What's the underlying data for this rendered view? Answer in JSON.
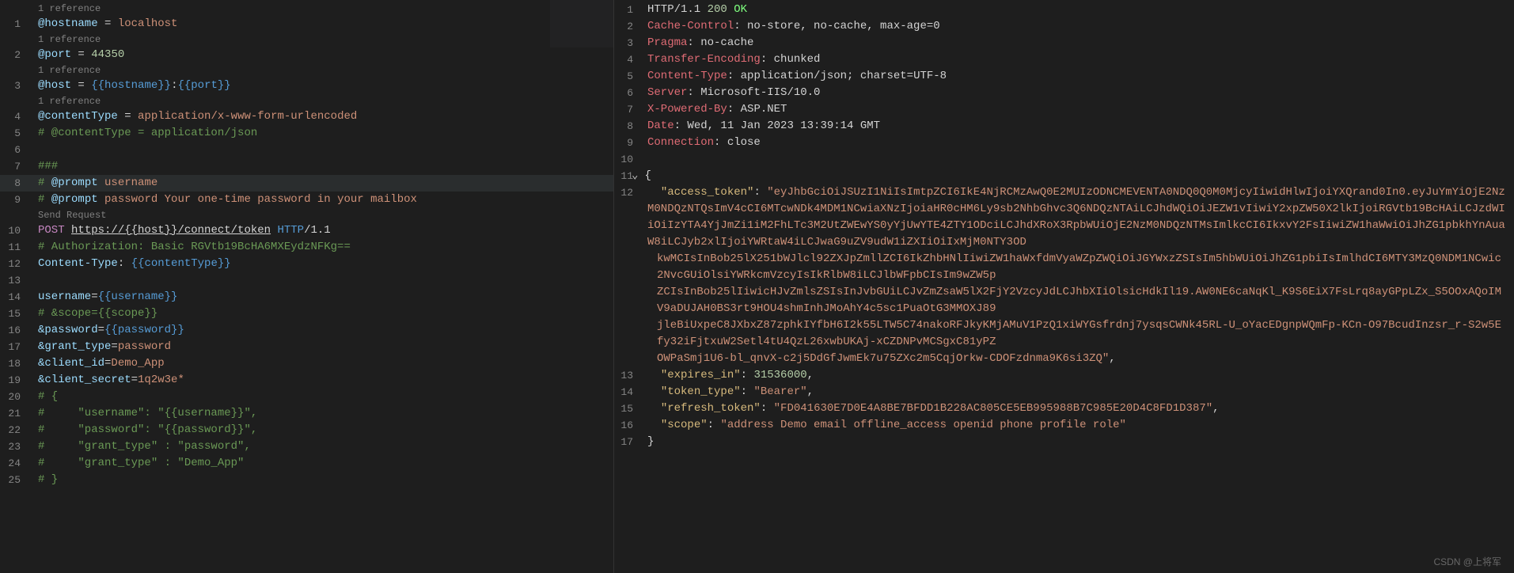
{
  "watermark": "CSDN @上将军",
  "left": {
    "codelens": {
      "references1": "1 reference",
      "send": "Send Request"
    },
    "lines": [
      {
        "n": "",
        "codelens": "references1"
      },
      {
        "n": "1",
        "bar": "",
        "tokens": [
          [
            "@hostname",
            "var"
          ],
          [
            " = ",
            "op"
          ],
          [
            "localhost",
            "val"
          ]
        ]
      },
      {
        "n": "",
        "codelens": "references1"
      },
      {
        "n": "2",
        "bar": "",
        "tokens": [
          [
            "@port",
            "var"
          ],
          [
            " = ",
            "op"
          ],
          [
            "44350",
            "num"
          ]
        ]
      },
      {
        "n": "",
        "codelens": "references1"
      },
      {
        "n": "3",
        "bar": "",
        "tokens": [
          [
            "@host",
            "var"
          ],
          [
            " = ",
            "op"
          ],
          [
            "{{hostname}}",
            "tpl"
          ],
          [
            ":",
            "op"
          ],
          [
            "{{port}}",
            "tpl"
          ]
        ]
      },
      {
        "n": "",
        "codelens": "references1"
      },
      {
        "n": "4",
        "bar": "",
        "tokens": [
          [
            "@contentType",
            "var"
          ],
          [
            " = ",
            "op"
          ],
          [
            "application/x-www-form-urlencoded",
            "val"
          ]
        ]
      },
      {
        "n": "5",
        "bar": "blue",
        "tokens": [
          [
            "# @contentType = application/json",
            "cmt"
          ]
        ]
      },
      {
        "n": "6",
        "bar": "",
        "tokens": [
          [
            "",
            "op"
          ]
        ]
      },
      {
        "n": "7",
        "bar": "",
        "tokens": [
          [
            "###",
            "cmt"
          ]
        ]
      },
      {
        "n": "8",
        "bar": "",
        "active": true,
        "tokens": [
          [
            "# ",
            "cmt"
          ],
          [
            "@prompt",
            "var"
          ],
          [
            " ",
            "op"
          ],
          [
            "username",
            "val"
          ]
        ]
      },
      {
        "n": "9",
        "bar": "",
        "tokens": [
          [
            "# ",
            "cmt"
          ],
          [
            "@prompt",
            "var"
          ],
          [
            " ",
            "op"
          ],
          [
            "password",
            "val"
          ],
          [
            " ",
            "op"
          ],
          [
            "Your one-time password in your mailbox",
            "val"
          ]
        ]
      },
      {
        "n": "",
        "codelens": "send"
      },
      {
        "n": "10",
        "bar": "",
        "tokens": [
          [
            "POST",
            "mtd"
          ],
          [
            " ",
            "op"
          ],
          [
            "https://{{host}}/connect/token",
            "url"
          ],
          [
            " ",
            "op"
          ],
          [
            "HTTP",
            "kw"
          ],
          [
            "/1.1",
            "op"
          ]
        ]
      },
      {
        "n": "11",
        "bar": "blue",
        "tokens": [
          [
            "# Authorization: Basic RGVtb19BcHA6MXEydzNFKg==",
            "cmt"
          ]
        ]
      },
      {
        "n": "12",
        "bar": "",
        "tokens": [
          [
            "Content-Type",
            "var"
          ],
          [
            ": ",
            "op"
          ],
          [
            "{{contentType}}",
            "tpl"
          ]
        ]
      },
      {
        "n": "13",
        "bar": "",
        "tokens": [
          [
            "",
            "op"
          ]
        ]
      },
      {
        "n": "14",
        "bar": "",
        "tokens": [
          [
            "username",
            "var"
          ],
          [
            "=",
            "op"
          ],
          [
            "{{username}}",
            "tpl"
          ]
        ]
      },
      {
        "n": "15",
        "bar": "blue",
        "tokens": [
          [
            "# &scope={{scope}}",
            "cmt"
          ]
        ]
      },
      {
        "n": "16",
        "bar": "",
        "tokens": [
          [
            "&password",
            "var"
          ],
          [
            "=",
            "op"
          ],
          [
            "{{password}}",
            "tpl"
          ]
        ]
      },
      {
        "n": "17",
        "bar": "",
        "tokens": [
          [
            "&grant_type",
            "var"
          ],
          [
            "=",
            "op"
          ],
          [
            "password",
            "val"
          ]
        ]
      },
      {
        "n": "18",
        "bar": "",
        "tokens": [
          [
            "&client_id",
            "var"
          ],
          [
            "=",
            "op"
          ],
          [
            "Demo_App",
            "val"
          ]
        ]
      },
      {
        "n": "19",
        "bar": "blue",
        "tokens": [
          [
            "&client_secret",
            "var"
          ],
          [
            "=",
            "op"
          ],
          [
            "1q2w3e*",
            "val"
          ]
        ]
      },
      {
        "n": "20",
        "bar": "",
        "tokens": [
          [
            "# {",
            "cmt"
          ]
        ]
      },
      {
        "n": "21",
        "bar": "blue",
        "tokens": [
          [
            "#     \"username\": \"{{username}}\",",
            "cmt"
          ]
        ]
      },
      {
        "n": "22",
        "bar": "blue",
        "tokens": [
          [
            "#     \"password\": \"{{password}}\",",
            "cmt"
          ]
        ]
      },
      {
        "n": "23",
        "bar": "blue",
        "tokens": [
          [
            "#     \"grant_type\" : \"password\",",
            "cmt"
          ]
        ]
      },
      {
        "n": "24",
        "bar": "blue",
        "tokens": [
          [
            "#     \"grant_type\" : \"Demo_App\"",
            "cmt"
          ]
        ]
      },
      {
        "n": "25",
        "bar": "",
        "tokens": [
          [
            "# }",
            "cmt"
          ]
        ]
      }
    ]
  },
  "right": {
    "lines": [
      {
        "n": "1",
        "tokens": [
          [
            "HTTP/1.1 ",
            "ht"
          ],
          [
            "200",
            "ok"
          ],
          [
            " ",
            "ht"
          ],
          [
            "OK",
            "okw"
          ]
        ]
      },
      {
        "n": "2",
        "tokens": [
          [
            "Cache-Control",
            "hdr"
          ],
          [
            ":",
            "ht"
          ],
          [
            " no-store, no-cache, max-age=0",
            "ht"
          ]
        ]
      },
      {
        "n": "3",
        "tokens": [
          [
            "Pragma",
            "hdr"
          ],
          [
            ":",
            "ht"
          ],
          [
            " no-cache",
            "ht"
          ]
        ]
      },
      {
        "n": "4",
        "tokens": [
          [
            "Transfer-Encoding",
            "hdr"
          ],
          [
            ":",
            "ht"
          ],
          [
            " chunked",
            "ht"
          ]
        ]
      },
      {
        "n": "5",
        "tokens": [
          [
            "Content-Type",
            "hdr"
          ],
          [
            ":",
            "ht"
          ],
          [
            " application/json; charset=UTF-8",
            "ht"
          ]
        ]
      },
      {
        "n": "6",
        "tokens": [
          [
            "Server",
            "hdr"
          ],
          [
            ":",
            "ht"
          ],
          [
            " Microsoft-IIS/10.0",
            "ht"
          ]
        ]
      },
      {
        "n": "7",
        "tokens": [
          [
            "X-Powered-By",
            "hdr"
          ],
          [
            ":",
            "ht"
          ],
          [
            " ASP.NET",
            "ht"
          ]
        ]
      },
      {
        "n": "8",
        "tokens": [
          [
            "Date",
            "hdr"
          ],
          [
            ":",
            "ht"
          ],
          [
            " Wed, 11 Jan 2023 13:39:14 GMT",
            "ht"
          ]
        ]
      },
      {
        "n": "9",
        "tokens": [
          [
            "Connection",
            "hdr"
          ],
          [
            ":",
            "ht"
          ],
          [
            " close",
            "ht"
          ]
        ]
      },
      {
        "n": "10",
        "tokens": [
          [
            "",
            "ht"
          ]
        ]
      },
      {
        "n": "11",
        "fold": true,
        "tokens": [
          [
            "{",
            "pun"
          ]
        ]
      },
      {
        "n": "12",
        "tokens": [
          [
            "  ",
            "pun"
          ],
          [
            "\"access_token\"",
            "key"
          ],
          [
            ":",
            "pun"
          ],
          [
            " ",
            "pun"
          ],
          [
            "\"eyJhbGciOiJSUzI1NiIsImtpZCI6IkE4NjRCMzAwQ0E2MUIzODNCMEVENTA0NDQ0Q0M0MjcyIiwidHlwIjoiYXQrand0In0.eyJuYmYiOjE2NzM0NDQzNTQsImV4cCI6MTcwNDk4MDM1NCwiaXNzIjoiaHR0cHM6Ly9sb2NhbGhvc3Q6NDQzNTAiLCJhdWQiOiJEZW1vIiwiY2xpZW50X2lkIjoiRGVtb19BcHAiLCJzdWIiOiIzYTA4YjJmZi1iM2FhLTc3M2UtZWEwYS0yYjUwYTE4ZTY1ODciLCJhdXRoX3RpbWUiOjE2NzM0NDQzNTMsImlkcCI6IkxvY2FsIiwiZW1haWwiOiJhZG1pbkhYnAuaW8iLCJyb2xlIjoiYWRtaW4iLCJwaG9uZV9udW1iZXIiOiIxMjM0NTY3OD",
            "str"
          ]
        ]
      },
      {
        "n": "",
        "cont": true,
        "tokens": [
          [
            "kwMCIsInBob25lX251bWJlcl92ZXJpZmllZCI6IkZhbHNlIiwiZW1haWxfdmVyaWZpZWQiOiJGYWxzZSIsIm5hbWUiOiJhZG1pbiIsImlhdCI6MTY3MzQ0NDM1NCwic2NvcGUiOlsiYWRkcmVzcyIsIkRlbW8iLCJlbWFpbCIsIm9wZW5p",
            "str"
          ]
        ]
      },
      {
        "n": "",
        "cont": true,
        "tokens": [
          [
            "ZCIsInBob25lIiwicHJvZmlsZSIsInJvbGUiLCJvZmZsaW5lX2FjY2VzcyJdLCJhbXIiOlsicHdkIl19.AW0NE6caNqKl_K9S6EiX7FsLrq8ayGPpLZx_S5OOxAQoIMV9aDUJAH0BS3rt9HOU4shmInhJMoAhY4c5sc1PuaOtG3MMOXJ89",
            "str"
          ]
        ]
      },
      {
        "n": "",
        "cont": true,
        "tokens": [
          [
            "jleBiUxpeC8JXbxZ87zphkIYfbH6I2k55LTW5C74nakoRFJkyKMjAMuV1PzQ1xiWYGsfrdnj7ysqsCWNk45RL-U_oYacEDgnpWQmFp-KCn-O97BcudInzsr_r-S2w5Efy32iFjtxuW2Setl4tU4QzL26xwbUKAj-xCZDNPvMCSgxC81yPZ",
            "str"
          ]
        ]
      },
      {
        "n": "",
        "cont": true,
        "tokens": [
          [
            "OWPaSmj1U6-bl_qnvX-c2j5DdGfJwmEk7u75ZXc2m5CqjOrkw-CDOFzdnma9K6si3ZQ\"",
            "str"
          ],
          [
            ",",
            "pun"
          ]
        ]
      },
      {
        "n": "13",
        "tokens": [
          [
            "  ",
            "pun"
          ],
          [
            "\"expires_in\"",
            "key"
          ],
          [
            ":",
            "pun"
          ],
          [
            " ",
            "pun"
          ],
          [
            "31536000",
            "num"
          ],
          [
            ",",
            "pun"
          ]
        ]
      },
      {
        "n": "14",
        "tokens": [
          [
            "  ",
            "pun"
          ],
          [
            "\"token_type\"",
            "key"
          ],
          [
            ":",
            "pun"
          ],
          [
            " ",
            "pun"
          ],
          [
            "\"Bearer\"",
            "str"
          ],
          [
            ",",
            "pun"
          ]
        ]
      },
      {
        "n": "15",
        "tokens": [
          [
            "  ",
            "pun"
          ],
          [
            "\"refresh_token\"",
            "key"
          ],
          [
            ":",
            "pun"
          ],
          [
            " ",
            "pun"
          ],
          [
            "\"FD041630E7D0E4A8BE7BFDD1B228AC805CE5EB995988B7C985E20D4C8FD1D387\"",
            "str"
          ],
          [
            ",",
            "pun"
          ]
        ]
      },
      {
        "n": "16",
        "tokens": [
          [
            "  ",
            "pun"
          ],
          [
            "\"scope\"",
            "key"
          ],
          [
            ":",
            "pun"
          ],
          [
            " ",
            "pun"
          ],
          [
            "\"address Demo email offline_access openid phone profile role\"",
            "str"
          ]
        ]
      },
      {
        "n": "17",
        "tokens": [
          [
            "}",
            "pun"
          ]
        ]
      }
    ]
  }
}
